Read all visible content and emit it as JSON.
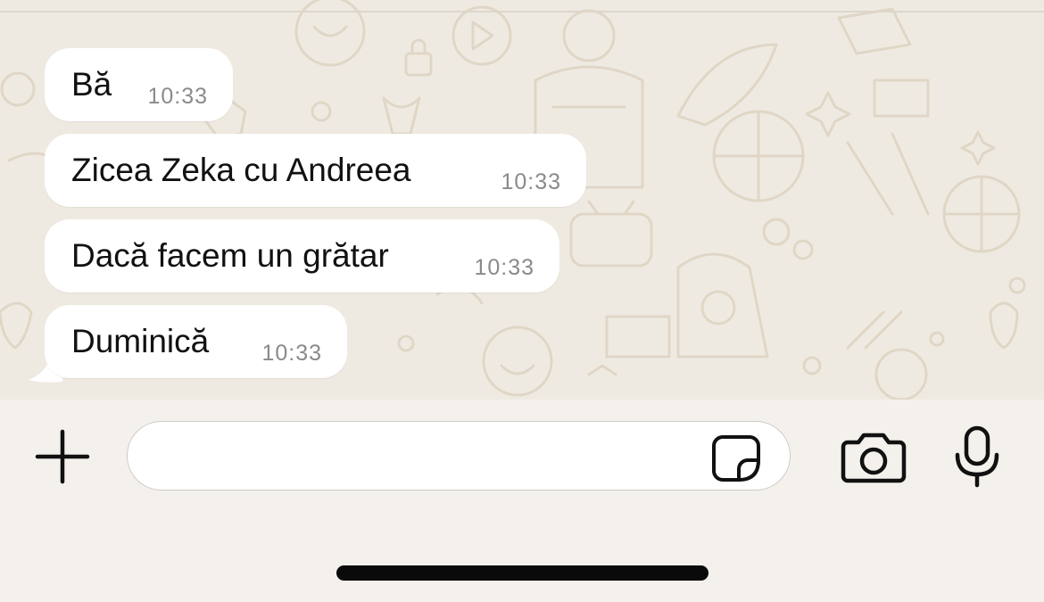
{
  "messages": [
    {
      "text": "Bă",
      "time": "10:33"
    },
    {
      "text": "Zicea Zeka cu Andreea",
      "time": "10:33"
    },
    {
      "text": "Dacă facem un grătar",
      "time": "10:33"
    },
    {
      "text": "Duminică",
      "time": "10:33"
    }
  ],
  "composer": {
    "value": "",
    "attach_icon": "plus-icon",
    "sticker_icon": "sticker-icon",
    "camera_icon": "camera-icon",
    "mic_icon": "microphone-icon"
  },
  "colors": {
    "chat_background": "#efeae1",
    "bubble": "#ffffff",
    "text": "#111111",
    "timestamp": "#8a8a8a",
    "composer_background": "#f4f1ec"
  }
}
